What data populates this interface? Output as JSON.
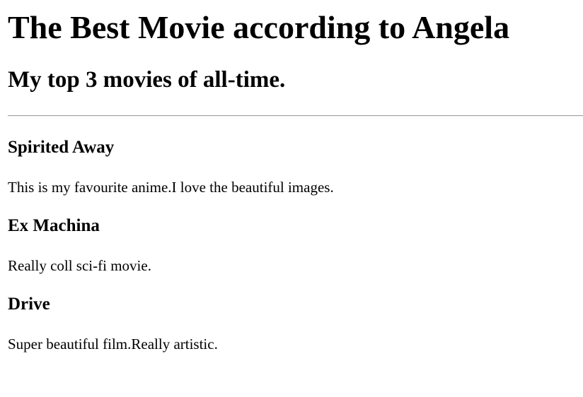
{
  "header": {
    "title": "The Best Movie according to Angela",
    "subtitle": "My top 3 movies of all-time."
  },
  "movies": [
    {
      "title": "Spirited Away",
      "description": "This is my favourite anime.I love the beautiful images."
    },
    {
      "title": "Ex Machina",
      "description": "Really coll sci-fi movie."
    },
    {
      "title": "Drive",
      "description": "Super beautiful film.Really artistic."
    }
  ]
}
